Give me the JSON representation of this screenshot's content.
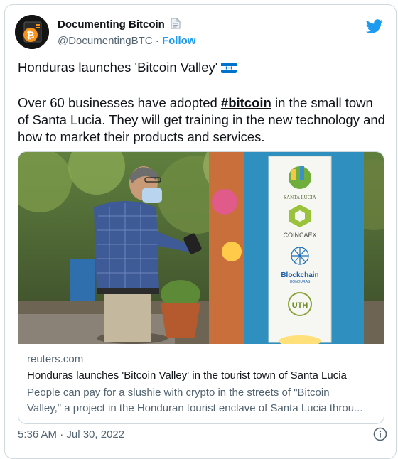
{
  "author": {
    "display_name": "Documenting Bitcoin",
    "handle": "@DocumentingBTC",
    "separator": " · ",
    "follow_label": "Follow"
  },
  "tweet": {
    "line1": "Honduras launches 'Bitcoin Valley'",
    "line2_before": "Over 60 businesses have adopted ",
    "hashtag": "#bitcoin",
    "line2_after": " in the small town of Santa Lucia. They will get training in the new technology and how to market their products and services."
  },
  "card": {
    "domain": "reuters.com",
    "title": "Honduras launches 'Bitcoin Valley' in the tourist town of Santa Lucia",
    "desc_line1": "People can pay for a slushie with crypto in the streets of \"Bitcoin",
    "desc_line2": "Valley,\" a project in the Honduran tourist enclave of Santa Lucia throu...",
    "banner": {
      "town": "SANTA LUCIA",
      "sponsor1": "COINCAEX",
      "sponsor2": "Blockchain",
      "sponsor2_sub": "HONDURAS",
      "sponsor3": "UTH"
    }
  },
  "footer": {
    "timestamp": "5:36 AM · Jul 30, 2022"
  },
  "colors": {
    "twitter_blue": "#1d9bf0",
    "text": "#0f1419",
    "secondary": "#536471",
    "border": "#cfd9de"
  }
}
